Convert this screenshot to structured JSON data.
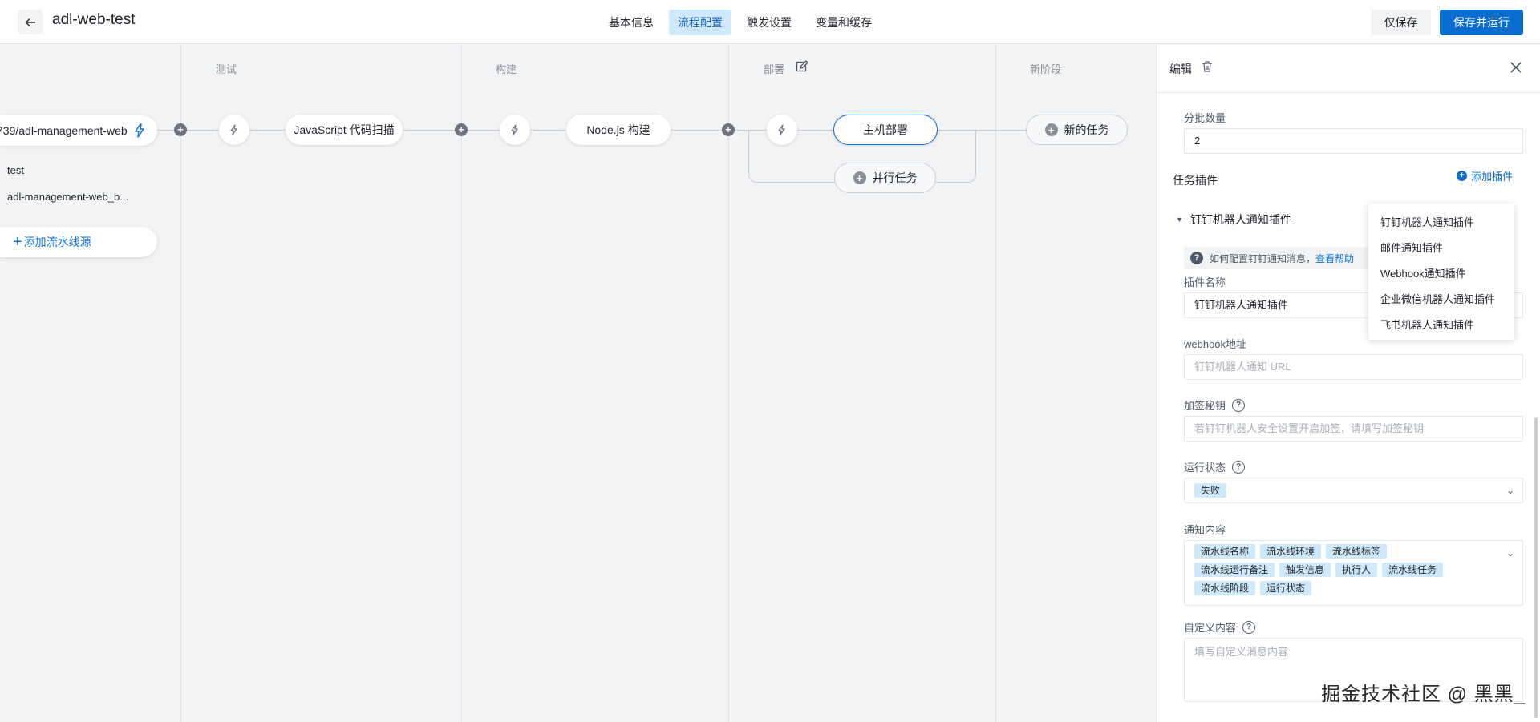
{
  "header": {
    "back_icon": "arrow-left-icon",
    "title": "adl-web-test",
    "tabs": [
      {
        "label": "基本信息",
        "active": false
      },
      {
        "label": "流程配置",
        "active": true
      },
      {
        "label": "触发设置",
        "active": false
      },
      {
        "label": "变量和缓存",
        "active": false
      }
    ],
    "save_label": "仅保存",
    "save_run_label": "保存并运行",
    "accent": "#0a6ed1"
  },
  "canvas": {
    "source": {
      "name": "739/adl-management-web",
      "branches": [
        "test",
        "adl-management-web_b..."
      ],
      "add_label": "添加流水线源"
    },
    "stages": [
      {
        "name": "测试",
        "tasks": [
          "JavaScript 代码扫描"
        ]
      },
      {
        "name": "构建",
        "tasks": [
          "Node.js 构建"
        ]
      },
      {
        "name": "部署",
        "tasks": [
          "主机部署"
        ],
        "parallel_label": "并行任务"
      },
      {
        "name": "新阶段",
        "new_task_label": "新的任务"
      }
    ]
  },
  "panel": {
    "title": "编辑",
    "batch_label": "分批数量",
    "batch_value": "2",
    "plugins_title": "任务插件",
    "add_plugin_label": "添加插件",
    "plugin_name_header": "钉钉机器人通知插件",
    "help_text": "如何配置钉钉通知消息，",
    "help_link": "查看帮助",
    "plugin_name_label": "插件名称",
    "plugin_name_value": "钉钉机器人通知插件",
    "webhook_label": "webhook地址",
    "webhook_placeholder": "钉钉机器人通知 URL",
    "secret_label": "加签秘钥",
    "secret_placeholder": "若钉钉机器人安全设置开启加签，请填写加签秘钥",
    "run_status_label": "运行状态",
    "run_status_tags": [
      "失败"
    ],
    "notify_label": "通知内容",
    "notify_tags": [
      "流水线名称",
      "流水线环境",
      "流水线标签",
      "流水线运行备注",
      "触发信息",
      "执行人",
      "流水线任务",
      "流水线阶段",
      "运行状态"
    ],
    "custom_label": "自定义内容",
    "custom_placeholder": "填写自定义消息内容"
  },
  "plugin_dropdown": {
    "items": [
      "钉钉机器人通知插件",
      "邮件通知插件",
      "Webhook通知插件",
      "企业微信机器人通知插件",
      "飞书机器人通知插件"
    ]
  },
  "watermark": "掘金技术社区 @ 黑黑_"
}
